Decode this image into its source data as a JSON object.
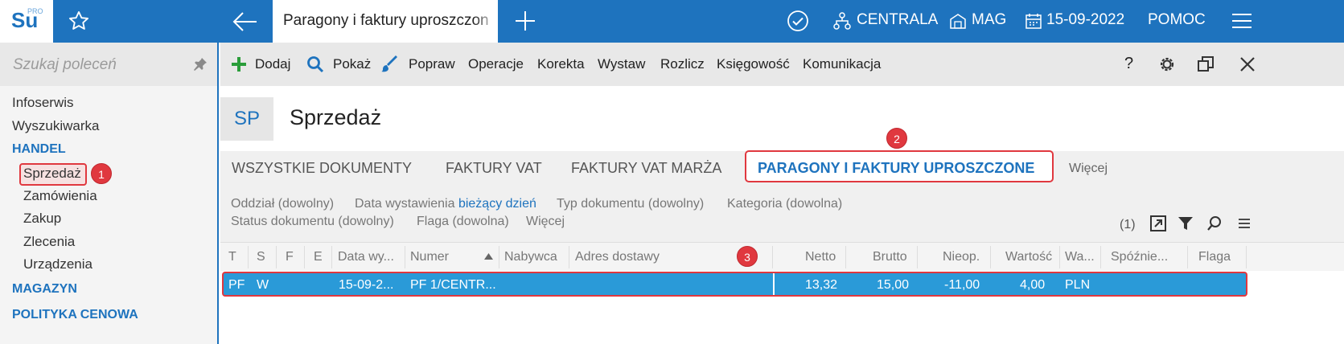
{
  "app": {
    "logo_text": "Su",
    "logo_badge": "PRO",
    "active_tab_title": "Paragony i faktury uproszczone",
    "top_menu": {
      "branch": "CENTRALA",
      "warehouse": "MAG",
      "date": "15-09-2022",
      "help": "POMOC"
    },
    "accent_color": "#1e73be",
    "highlight_color": "#e0383f"
  },
  "sidebar": {
    "search_placeholder": "Szukaj poleceń",
    "items": [
      {
        "label": "Infoserwis"
      },
      {
        "label": "Wyszukiwarka"
      },
      {
        "label": "HANDEL"
      },
      {
        "label": "Sprzedaż"
      },
      {
        "label": "Zamówienia"
      },
      {
        "label": "Zakup"
      },
      {
        "label": "Zlecenia"
      },
      {
        "label": "Urządzenia"
      },
      {
        "label": "MAGAZYN"
      },
      {
        "label": "POLITYKA CENOWA"
      }
    ]
  },
  "badges": [
    "1",
    "2",
    "3"
  ],
  "toolbar": {
    "add": "Dodaj",
    "show": "Pokaż",
    "edit": "Popraw",
    "operations": "Operacje",
    "correction": "Korekta",
    "issue": "Wystaw",
    "settle": "Rozlicz",
    "accounting": "Księgowość",
    "communication": "Komunikacja",
    "help": "?"
  },
  "module": {
    "code": "SP",
    "title": "Sprzedaż"
  },
  "doc_tabs": [
    {
      "label": "WSZYSTKIE DOKUMENTY"
    },
    {
      "label": "FAKTURY VAT"
    },
    {
      "label": "FAKTURY VAT MARŻA"
    },
    {
      "label": "PARAGONY I FAKTURY UPROSZCZONE"
    },
    {
      "label": "Więcej"
    }
  ],
  "filters": {
    "branch": "Oddział (dowolny)",
    "date_label": "Data wystawienia",
    "date_value": "bieżący dzień",
    "doc_type": "Typ dokumentu (dowolny)",
    "category": "Kategoria (dowolna)",
    "status": "Status dokumentu (dowolny)",
    "flag": "Flaga (dowolna)",
    "more": "Więcej",
    "count": "(1)"
  },
  "grid": {
    "columns": [
      "T",
      "S",
      "F",
      "E",
      "Data wy...",
      "Numer",
      "Nabywca",
      "Adres dostawy",
      "Netto",
      "Brutto",
      "Nieop.",
      "Wartość",
      "Wa...",
      "Spóźnie...",
      "Flaga"
    ],
    "rows": [
      {
        "T": "PF",
        "S": "W",
        "date": "15-09-2...",
        "number": "PF 1/CENTR...",
        "netto": "13,32",
        "brutto": "15,00",
        "unpaid": "-11,00",
        "value": "4,00",
        "currency": "PLN"
      }
    ]
  }
}
